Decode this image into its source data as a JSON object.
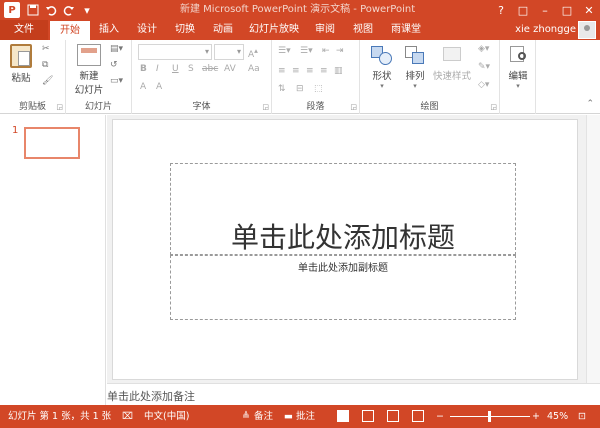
{
  "titlebar": {
    "title": "新建 Microsoft PowerPoint 演示文稿 - PowerPoint",
    "app_icon": "P",
    "qat": [
      "save-icon",
      "undo-icon",
      "redo-icon",
      "customize-icon"
    ],
    "window_controls": [
      "?",
      "□",
      "–",
      "□",
      "✕"
    ]
  },
  "tabs": {
    "file": "文件",
    "items": [
      "开始",
      "插入",
      "设计",
      "切换",
      "动画",
      "幻灯片放映",
      "审阅",
      "视图",
      "雨课堂"
    ],
    "active": "开始",
    "user": "xie zhongge"
  },
  "ribbon": {
    "groups": {
      "clipboard": "剪贴板",
      "slides": "幻灯片",
      "font": "字体",
      "paragraph": "段落",
      "drawing": "绘图",
      "editing": ""
    },
    "buttons": {
      "paste": "粘贴",
      "new_slide_line1": "新建",
      "new_slide_line2": "幻灯片",
      "shapes": "形状",
      "arrange": "排列",
      "quick_styles": "快速样式",
      "editing": "编辑"
    },
    "font_controls": [
      "B",
      "I",
      "U",
      "S",
      "abc",
      "AV",
      "A",
      "Aa",
      "A"
    ]
  },
  "thumbnails": {
    "slide_number": "1"
  },
  "slide": {
    "title_placeholder": "单击此处添加标题",
    "subtitle_placeholder": "单击此处添加副标题"
  },
  "notes": {
    "placeholder": "单击此处添加备注"
  },
  "statusbar": {
    "slide_info": "幻灯片 第 1 张，共 1 张",
    "language": "中文(中国)",
    "notes_label": "备注",
    "comments_label": "批注",
    "zoom_minus": "−",
    "zoom_plus": "+",
    "zoom": "45%"
  },
  "colors": {
    "accent": "#d24726",
    "accent_dark": "#c43e1c"
  }
}
